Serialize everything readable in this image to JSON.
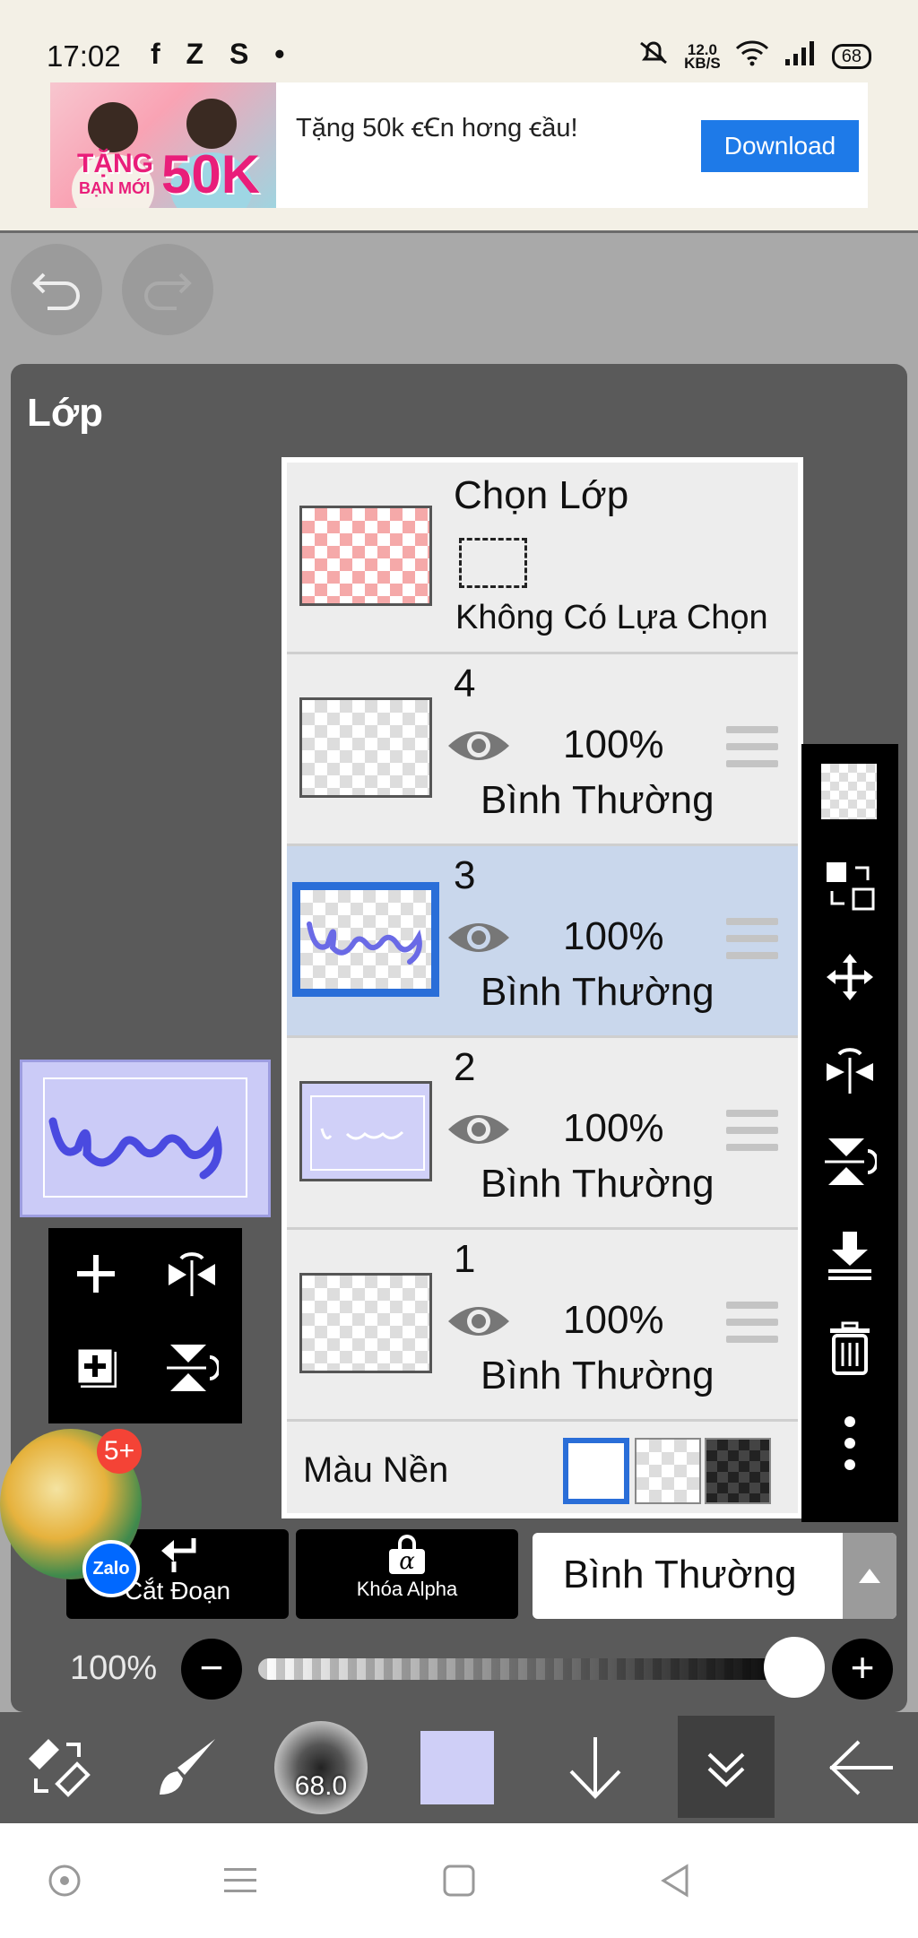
{
  "status_bar": {
    "time": "17:02",
    "apps": "f Z S •",
    "net_speed_value": "12.0",
    "net_speed_unit": "KB/S",
    "battery": "68"
  },
  "ad": {
    "text": "Tặng 50k ꞓꞒn hơng ꞓầu!",
    "image_text_1": "TẶNG",
    "image_text_2": "50K",
    "image_text_3": "BẠN MỚI",
    "button": "Download"
  },
  "panel": {
    "title": "Lớp"
  },
  "selection": {
    "title": "Chọn Lớp",
    "status": "Không Có Lựa Chọn"
  },
  "layers": [
    {
      "number": "4",
      "opacity": "100%",
      "mode": "Bình Thường"
    },
    {
      "number": "3",
      "opacity": "100%",
      "mode": "Bình Thường",
      "active": true
    },
    {
      "number": "2",
      "opacity": "100%",
      "mode": "Bình Thường"
    },
    {
      "number": "1",
      "opacity": "100%",
      "mode": "Bình Thường"
    }
  ],
  "background": {
    "label": "Màu Nền"
  },
  "bottom_actions": {
    "clip_label": "Cắt Đoạn",
    "alpha_lock_label": "Khóa Alpha",
    "alpha_symbol": "α",
    "blend_mode": "Bình Thường"
  },
  "opacity": {
    "label": "100%",
    "value": 1.0,
    "minus": "−",
    "plus": "+"
  },
  "toolbar": {
    "brush_size": "68.0",
    "color": "#cfcff7"
  },
  "bubble": {
    "badge": "5+",
    "app": "Zalo"
  },
  "colors": {
    "active_layer_bg": "#c9d7ec",
    "accent_blue": "#2a6ed8",
    "download_blue": "#1e7ae8"
  }
}
